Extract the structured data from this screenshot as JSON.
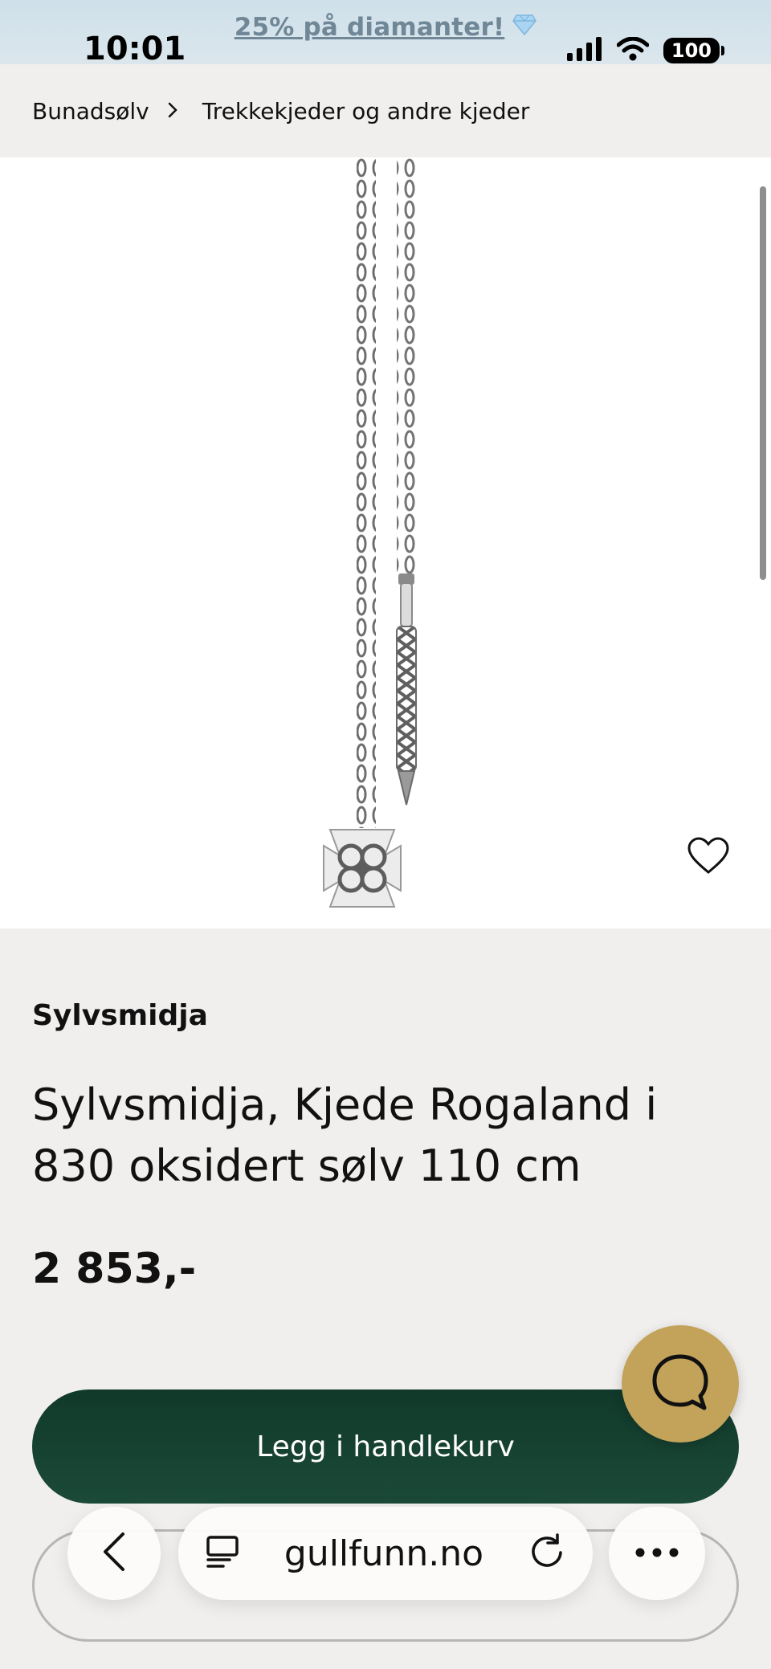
{
  "status_bar": {
    "time": "10:01",
    "battery": "100"
  },
  "promo": {
    "text": "25% på diamanter!"
  },
  "breadcrumb": {
    "items": [
      "Bunadsølv",
      "Trekkekjeder og andre kjeder"
    ]
  },
  "product": {
    "brand": "Sylvsmidja",
    "title": "Sylvsmidja, Kjede Rogaland i 830 oksidert sølv 110 cm",
    "price": "2 853,-"
  },
  "actions": {
    "add_to_cart_label": "Legg i handlekurv"
  },
  "browser": {
    "url": "gullfunn.no"
  },
  "colors": {
    "cart_button": "#10392a",
    "chat_button": "#c3a35a",
    "page_background": "#f1efed"
  },
  "icons": {
    "promo": "diamond-icon",
    "favorite": "heart-icon",
    "chat": "chat-bubble-icon",
    "back": "chevron-left-icon",
    "tabs": "tab-overview-icon",
    "reload": "reload-icon",
    "more": "ellipsis-icon"
  }
}
